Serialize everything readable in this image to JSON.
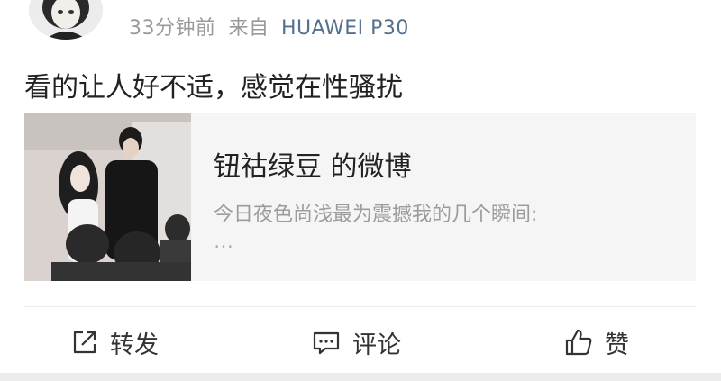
{
  "post": {
    "time": "33分钟前",
    "source_prefix": "来自",
    "device": "HUAWEI P30",
    "text": "看的让人好不适，感觉在性骚扰"
  },
  "card": {
    "title": "钮祜绿豆 的微博",
    "description": "今日夜色尚浅最为震撼我的几个瞬间:",
    "more": "…"
  },
  "actions": {
    "repost": "转发",
    "comment": "评论",
    "like": "赞"
  },
  "colors": {
    "link": "#54708f",
    "muted": "#9a9a9a",
    "card_bg": "#f5f5f5"
  }
}
